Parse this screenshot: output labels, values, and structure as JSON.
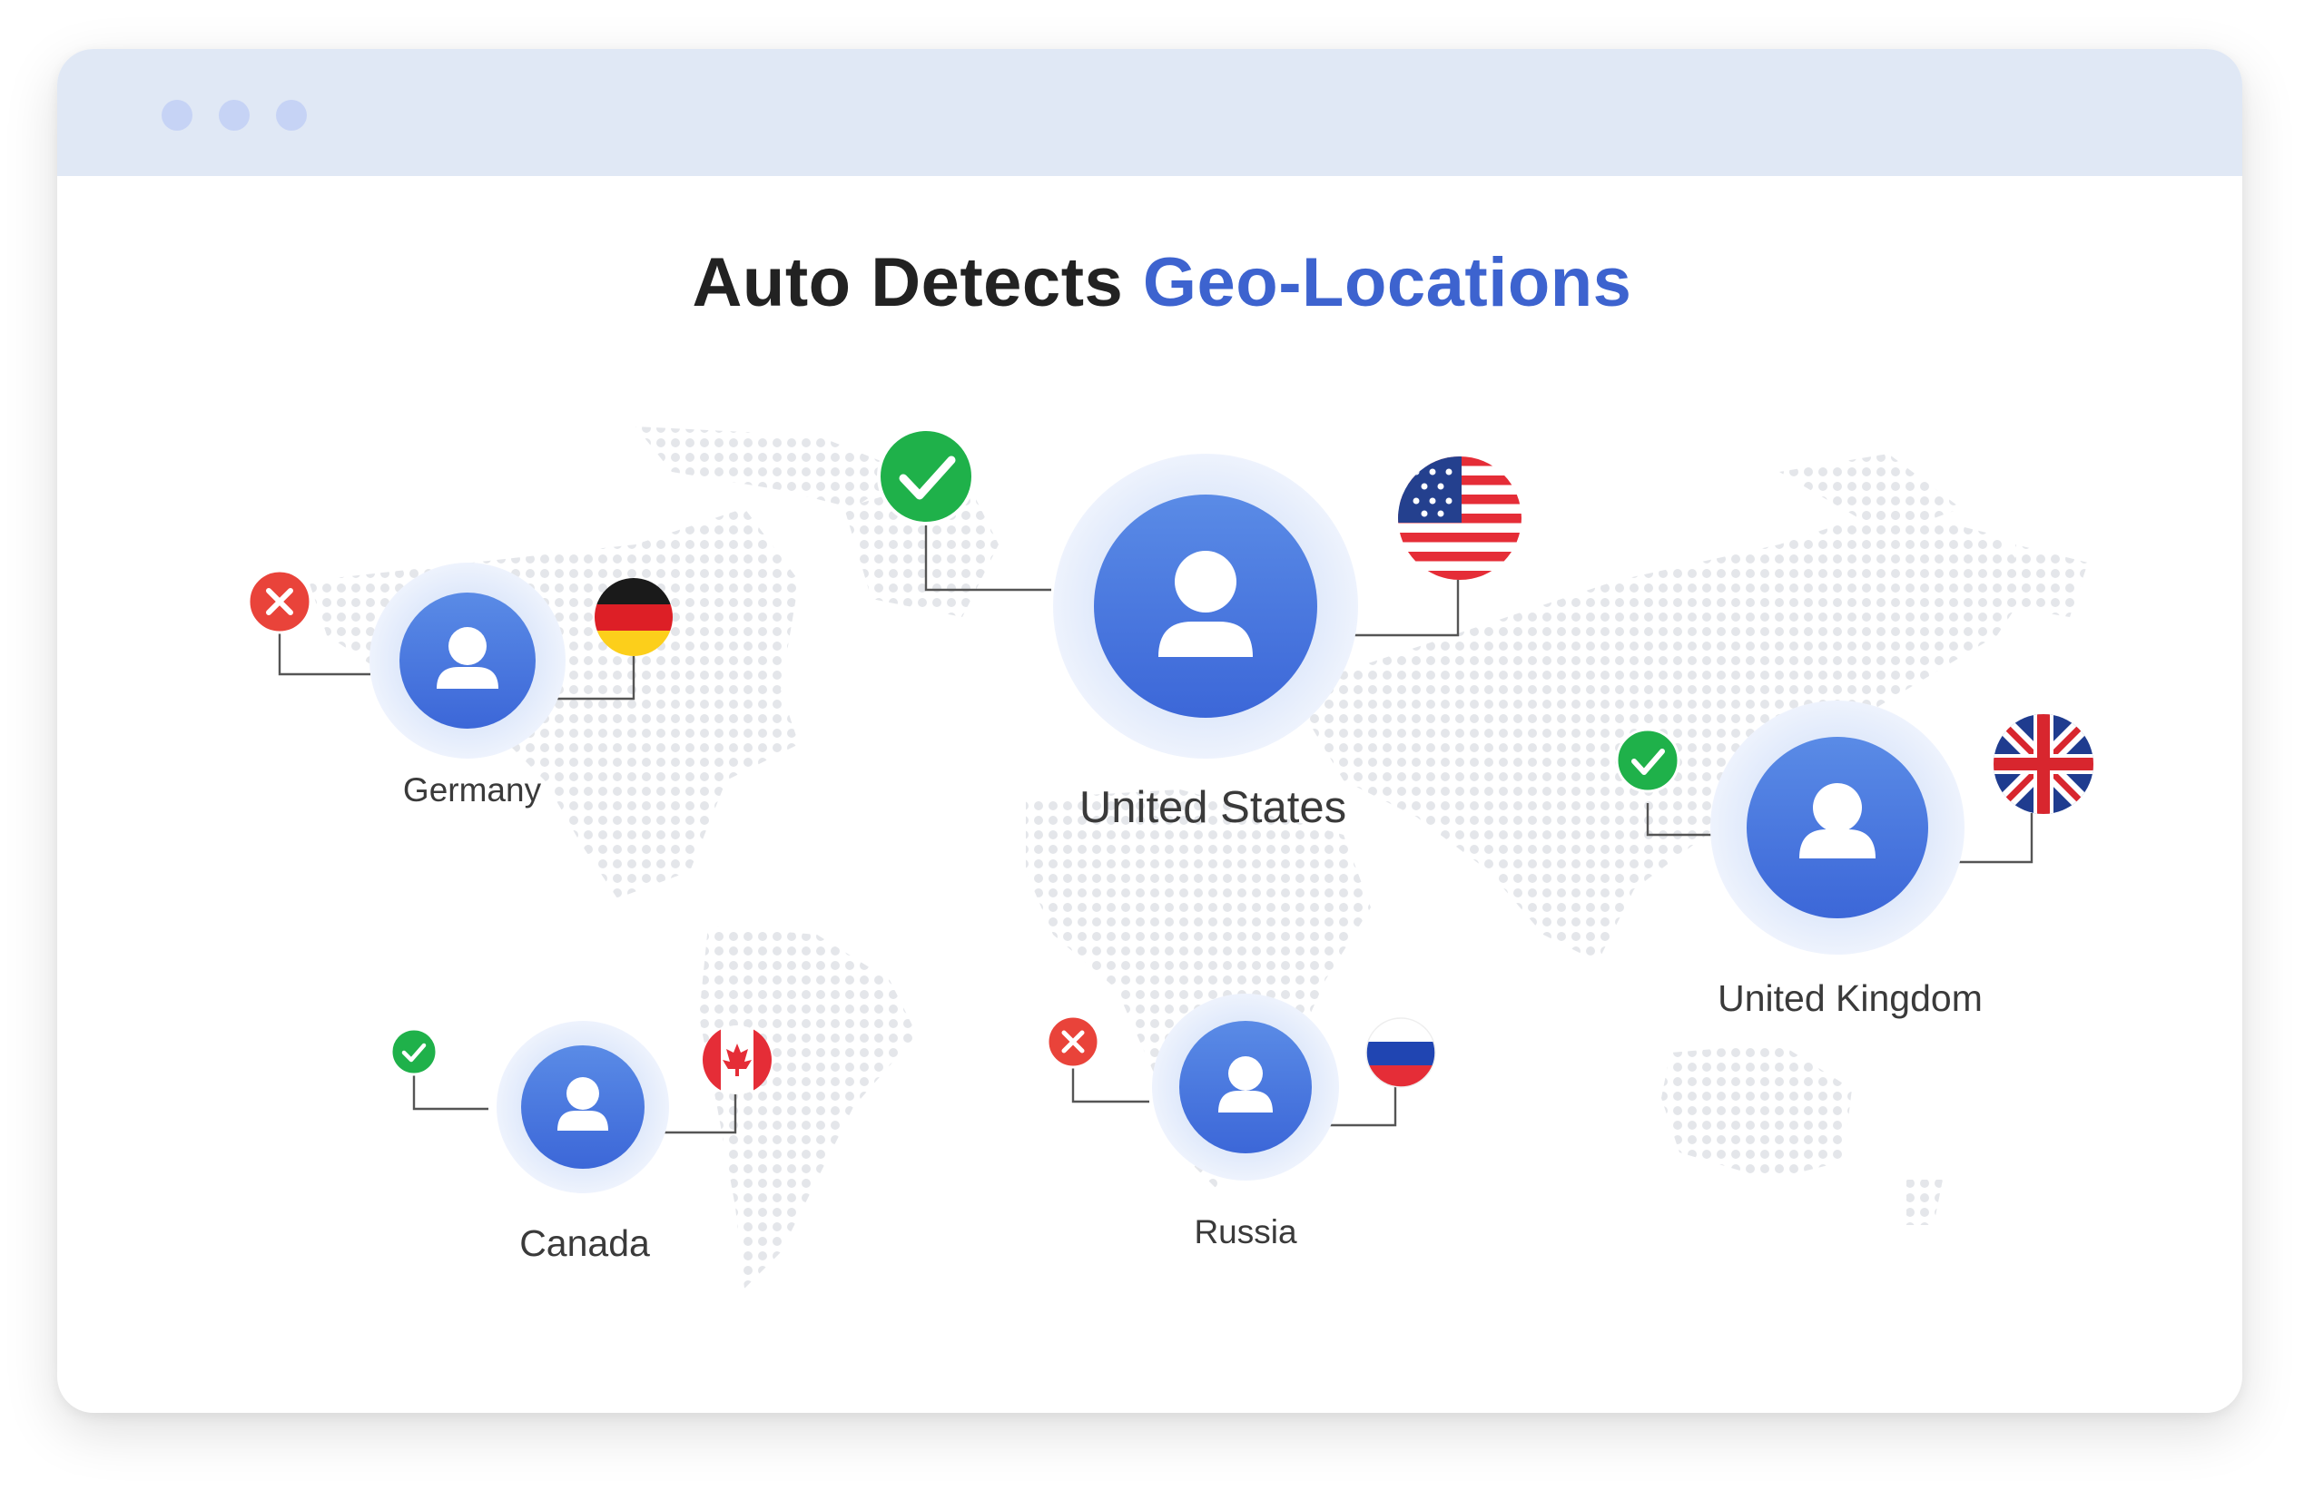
{
  "title": {
    "prefix": "Auto Detects",
    "accent": "Geo-Locations"
  },
  "colors": {
    "accent": "#3d63cf",
    "success": "#1fb14a",
    "error": "#e9433a",
    "avatar": "#4a7ee0",
    "titlebar": "#e0e8f5"
  },
  "locations": [
    {
      "label": "Germany",
      "status": "rejected",
      "status_icon": "close-icon",
      "flag": "germany-flag-icon"
    },
    {
      "label": "United States",
      "status": "approved",
      "status_icon": "check-icon",
      "flag": "usa-flag-icon"
    },
    {
      "label": "United Kingdom",
      "status": "approved",
      "status_icon": "check-icon",
      "flag": "uk-flag-icon"
    },
    {
      "label": "Canada",
      "status": "approved",
      "status_icon": "check-icon",
      "flag": "canada-flag-icon"
    },
    {
      "label": "Russia",
      "status": "rejected",
      "status_icon": "close-icon",
      "flag": "russia-flag-icon"
    }
  ]
}
